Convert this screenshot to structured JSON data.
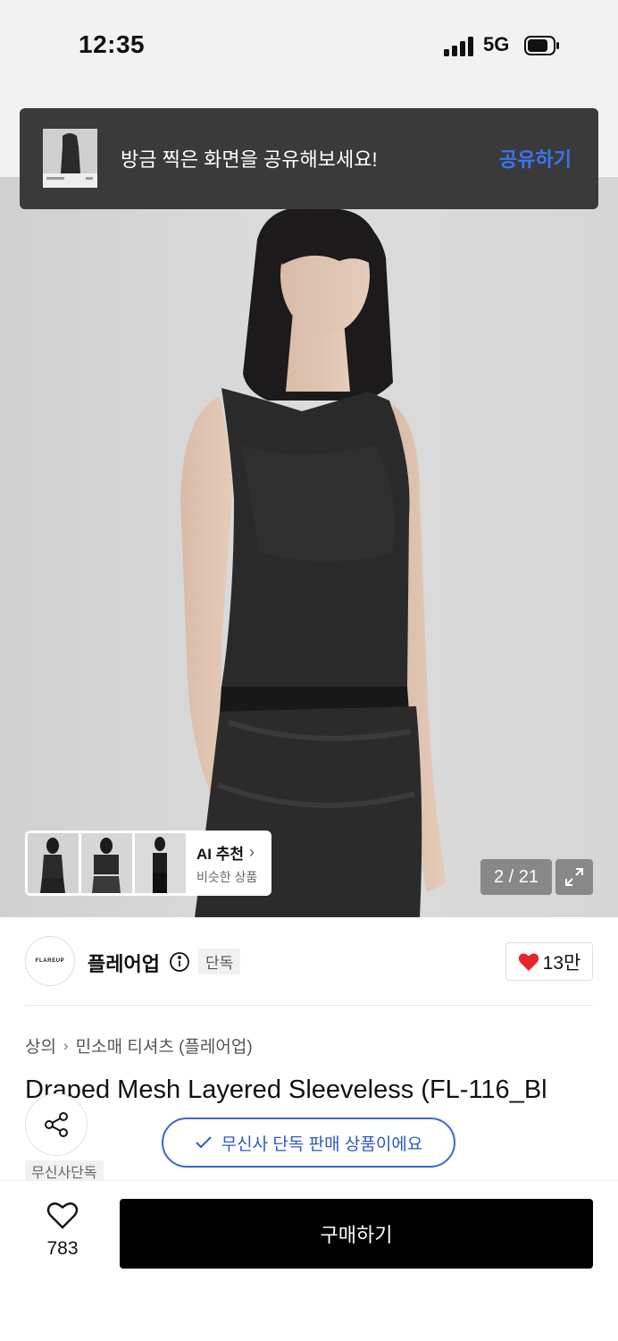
{
  "status_bar": {
    "time": "12:35",
    "network": "5G"
  },
  "toast": {
    "message": "방금 찍은 화면을 공유해보세요!",
    "action": "공유하기"
  },
  "gallery": {
    "ai_title": "AI 추천",
    "ai_subtitle": "비슷한 상품",
    "page_indicator": "2 / 21"
  },
  "brand": {
    "logo_text": "FLAREUP",
    "name": "플레어업",
    "tag": "단독",
    "like_count": "13만"
  },
  "breadcrumb": [
    "상의",
    "민소매 티셔츠 (플레어업)"
  ],
  "product": {
    "title": "Draped Mesh Layered Sleeveless (FL-116_Bl",
    "exclusive_notice": "무신사 단독 판매 상품이에요",
    "tag": "무신사단독"
  },
  "bottom_bar": {
    "wish_count": "783",
    "buy_label": "구매하기"
  },
  "colors": {
    "accent_blue": "#3b74f2",
    "heart_red": "#e8242b",
    "buy_bg": "#000000"
  }
}
